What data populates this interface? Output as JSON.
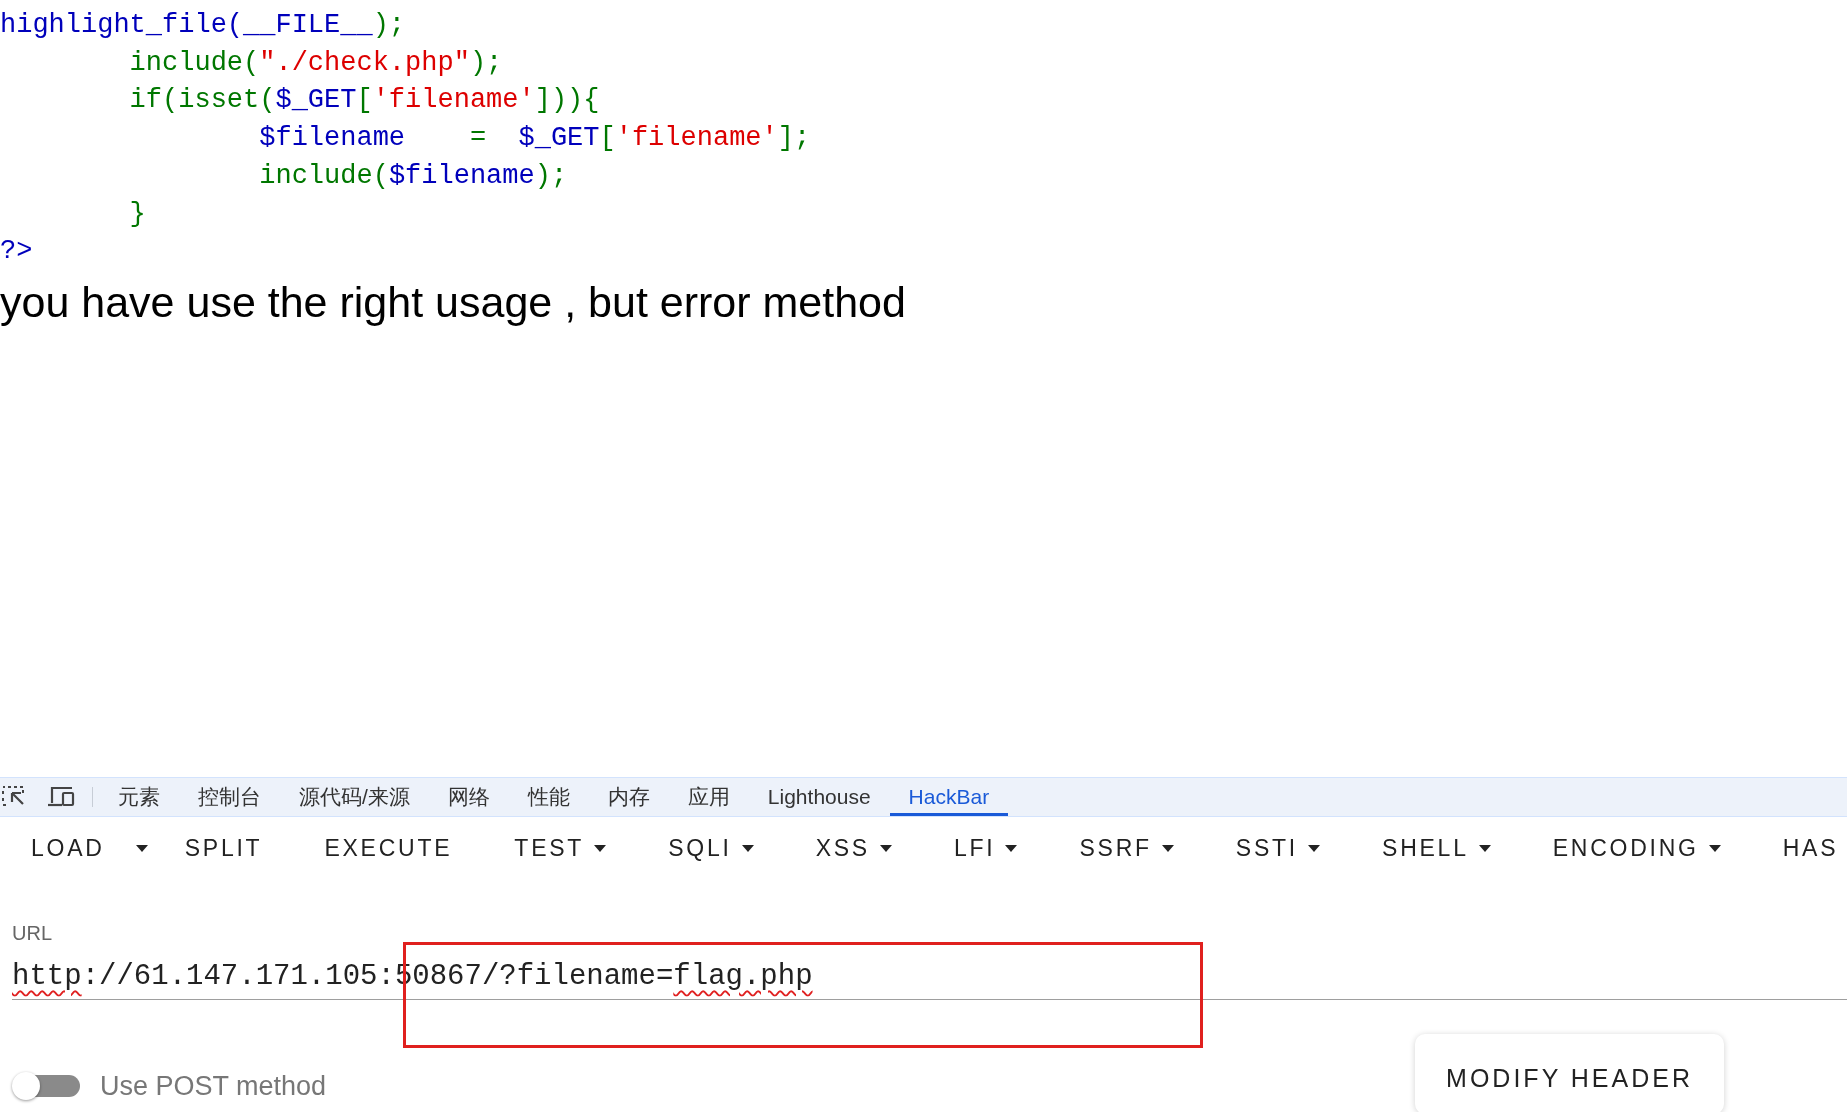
{
  "code_lines": [
    [
      {
        "text": "highlight_file(__FILE__",
        "kind": "default"
      },
      {
        "text": ");",
        "kind": "keyword"
      }
    ],
    [
      {
        "text": "        include(",
        "kind": "keyword"
      },
      {
        "text": "\"./check.php\"",
        "kind": "string"
      },
      {
        "text": ");",
        "kind": "keyword"
      }
    ],
    [
      {
        "text": "        if(isset(",
        "kind": "keyword"
      },
      {
        "text": "$_GET",
        "kind": "default"
      },
      {
        "text": "[",
        "kind": "keyword"
      },
      {
        "text": "'filename'",
        "kind": "string"
      },
      {
        "text": "])){",
        "kind": "keyword"
      }
    ],
    [
      {
        "text": "                $filename",
        "kind": "default"
      },
      {
        "text": "    =  ",
        "kind": "keyword"
      },
      {
        "text": "$_GET",
        "kind": "default"
      },
      {
        "text": "[",
        "kind": "keyword"
      },
      {
        "text": "'filename'",
        "kind": "string"
      },
      {
        "text": "];",
        "kind": "keyword"
      }
    ],
    [
      {
        "text": "                include(",
        "kind": "keyword"
      },
      {
        "text": "$filename",
        "kind": "default"
      },
      {
        "text": ");",
        "kind": "keyword"
      }
    ],
    [
      {
        "text": "        }",
        "kind": "keyword"
      }
    ],
    [
      {
        "text": "?>",
        "kind": "default"
      }
    ]
  ],
  "message": "you have use the right usage , but error method",
  "devtools": {
    "tabs": [
      {
        "label": "元素",
        "selected": false
      },
      {
        "label": "控制台",
        "selected": false
      },
      {
        "label": "源代码/来源",
        "selected": false
      },
      {
        "label": "网络",
        "selected": false
      },
      {
        "label": "性能",
        "selected": false
      },
      {
        "label": "内存",
        "selected": false
      },
      {
        "label": "应用",
        "selected": false
      },
      {
        "label": "Lighthouse",
        "selected": false
      },
      {
        "label": "HackBar",
        "selected": true
      }
    ]
  },
  "hackbar": {
    "buttons": [
      {
        "label": "LOAD",
        "kind": "split"
      },
      {
        "label": "SPLIT",
        "kind": "plain"
      },
      {
        "label": "EXECUTE",
        "kind": "plain"
      },
      {
        "label": "TEST",
        "kind": "menu"
      },
      {
        "label": "SQLI",
        "kind": "menu"
      },
      {
        "label": "XSS",
        "kind": "menu"
      },
      {
        "label": "LFI",
        "kind": "menu"
      },
      {
        "label": "SSRF",
        "kind": "menu"
      },
      {
        "label": "SSTI",
        "kind": "menu"
      },
      {
        "label": "SHELL",
        "kind": "menu"
      },
      {
        "label": "ENCODING",
        "kind": "menu"
      },
      {
        "label": "HAS",
        "kind": "plain"
      }
    ],
    "url_label": "URL",
    "url": [
      {
        "text": "http",
        "misspelled": true
      },
      {
        "text": "://61.147.171.105:50867/?filename=",
        "misspelled": false
      },
      {
        "text": "flag.php",
        "misspelled": true
      }
    ],
    "annotations": [
      {
        "kind": "rectangle"
      }
    ],
    "post_toggle": {
      "label": "Use POST method",
      "on": false
    },
    "modify_header_button": "MODIFY HEADER"
  }
}
